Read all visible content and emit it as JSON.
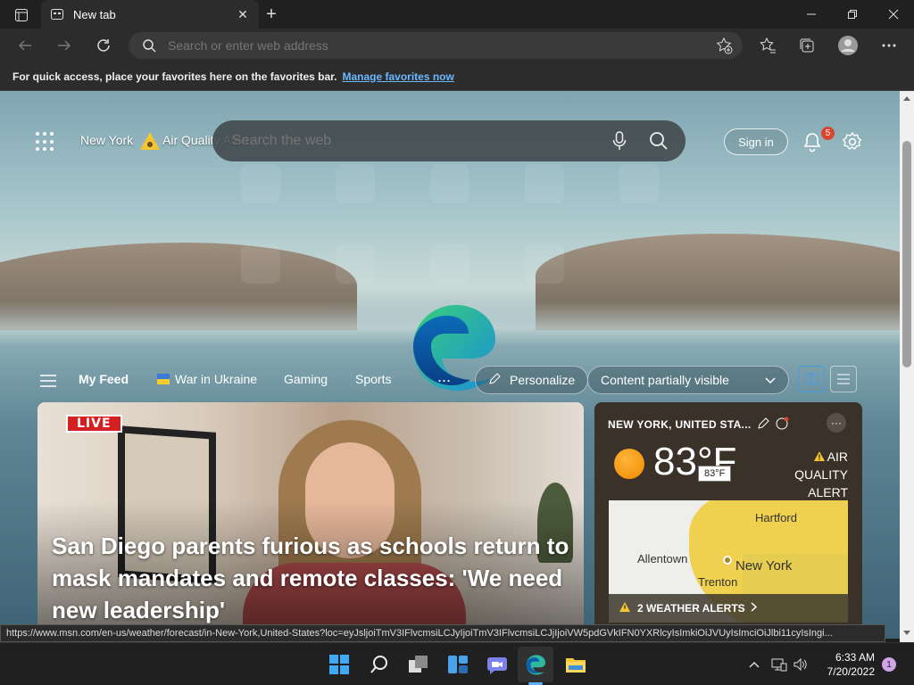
{
  "browser": {
    "tab_title": "New tab",
    "address_placeholder": "Search or enter web address",
    "favorites_message": "For quick access, place your favorites here on the favorites bar.",
    "favorites_link": "Manage favorites now"
  },
  "newtab": {
    "location": "New York",
    "air_quality": "Air Quality Alert",
    "search_placeholder": "Search the web",
    "sign_in": "Sign in",
    "notification_count": "5",
    "feed_tabs": [
      "My Feed",
      "War in Ukraine",
      "Gaming",
      "Sports"
    ],
    "more": "...",
    "personalize": "Personalize",
    "content_visibility": "Content partially visible",
    "hero": {
      "badge": "LIVE",
      "headline": "San Diego parents furious as schools return to mask mandates and remote classes: 'We need new leadership'"
    },
    "weather": {
      "location": "NEW YORK, UNITED STA...",
      "temp": "83",
      "unit": "°F",
      "tooltip": "83°F",
      "aq_alert": "AIR QUALITY ALERT",
      "map_cities": [
        "Hartford",
        "Allentown",
        "New York",
        "Trenton"
      ],
      "alerts": "2 WEATHER ALERTS"
    }
  },
  "status_url": "https://www.msn.com/en-us/weather/forecast/in-New-York,United-States?loc=eyJsljoiTmV3IFlvcmsiLCJyIjoiTmV3IFlvcmsiLCJjIjoiVW5pdGVkIFN0YXRlcyIsImkiOiJVUyIsImciOiJlbi11cyIsIngi...",
  "taskbar": {
    "time": "6:33 AM",
    "date": "7/20/2022",
    "notifications": "1"
  },
  "colors": {
    "accent_link": "#6cb8ff",
    "live_red": "#d42020",
    "badge_red": "#d9452d",
    "sun_orange": "#f08a00"
  }
}
